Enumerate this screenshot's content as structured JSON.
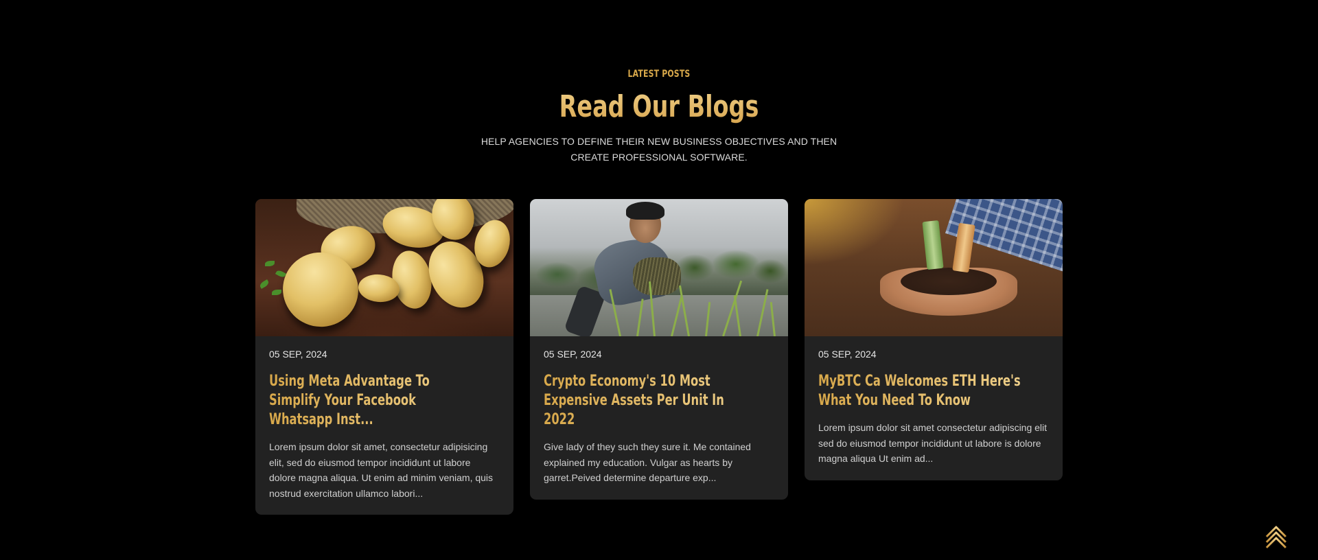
{
  "section": {
    "eyebrow": "LATEST POSTS",
    "title": "Read Our Blogs",
    "subtitle": "HELP AGENCIES TO DEFINE THEIR NEW BUSINESS OBJECTIVES AND THEN CREATE PROFESSIONAL SOFTWARE."
  },
  "posts": [
    {
      "date": "05 SEP, 2024",
      "title": "Using Meta Advantage To Simplify Your Facebook Whatsapp Inst...",
      "excerpt": "Lorem ipsum dolor sit amet, consectetur adipisicing elit, sed do eiusmod tempor incididunt ut labore dolore magna aliqua. Ut enim ad minim veniam, quis nostrud exercitation ullamco labori..."
    },
    {
      "date": "05 SEP, 2024",
      "title": "Crypto Economy's 10 Most Expensive Assets Per Unit In 2022",
      "excerpt": "Give lady of they such they sure it. Me contained explained my education. Vulgar as hearts by garret.Peived determine departure exp..."
    },
    {
      "date": "05 SEP, 2024",
      "title": "MyBTC Ca Welcomes ETH Here's What You Need To Know",
      "excerpt": "Lorem ipsum dolor sit amet consectetur adipiscing elit sed do eiusmod tempor incididunt ut labore is dolore magna aliqua Ut enim ad..."
    }
  ],
  "colors": {
    "background": "#000000",
    "card": "#222222",
    "accent_gold": "#d8a84a",
    "accent_gold_light": "#efd08a"
  },
  "icons": {
    "scroll_top": "chevrons-up-icon"
  }
}
